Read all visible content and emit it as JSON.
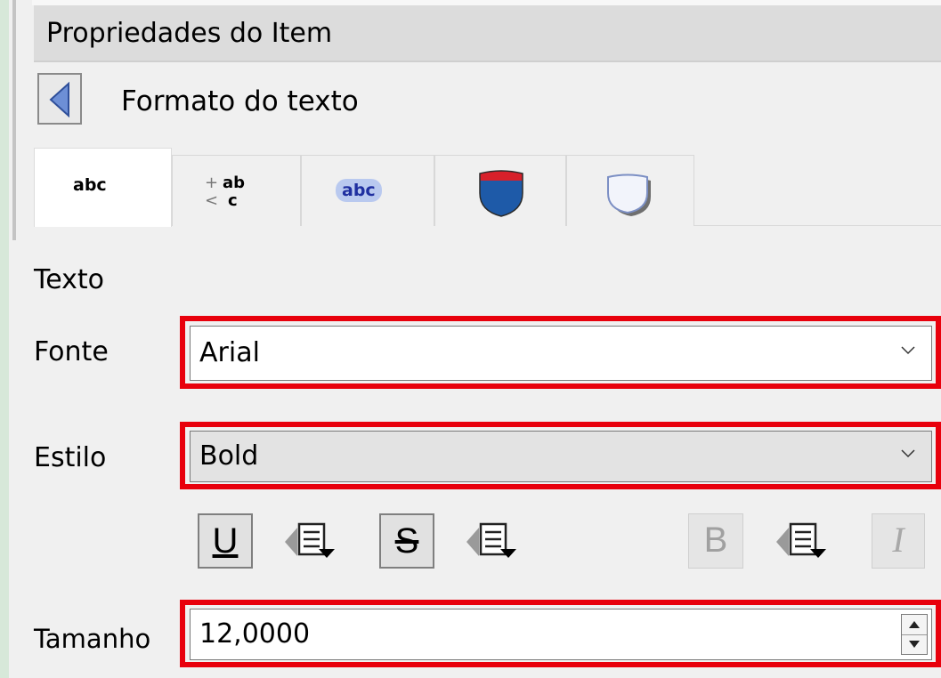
{
  "panel": {
    "title": "Propriedades do Item"
  },
  "section": {
    "title": "Formato do texto"
  },
  "tabs": [
    {
      "id": "text",
      "icon": "text-abc-icon",
      "glyph": "abc",
      "active": true
    },
    {
      "id": "formatting",
      "icon": "formatting-abc-icon",
      "glyph_top": "ab",
      "glyph_bottom": "c",
      "active": false
    },
    {
      "id": "buffer",
      "icon": "buffer-abc-icon",
      "glyph": "abc",
      "active": false
    },
    {
      "id": "background",
      "icon": "background-shield-icon",
      "active": false
    },
    {
      "id": "shadow",
      "icon": "shadow-shield-icon",
      "active": false
    }
  ],
  "text_group": {
    "label": "Texto",
    "font": {
      "label": "Fonte",
      "value": "Arial"
    },
    "style": {
      "label": "Estilo",
      "value": "Bold"
    },
    "toggles": {
      "underline": {
        "glyph": "U",
        "icon": "underline-icon"
      },
      "strikeout": {
        "glyph": "S",
        "icon": "strikeout-icon"
      },
      "bold": {
        "glyph": "B",
        "icon": "bold-icon",
        "enabled": false
      },
      "italic": {
        "glyph": "I",
        "icon": "italic-icon",
        "enabled": false
      },
      "override_icon": "data-defined-override-icon"
    },
    "size": {
      "label": "Tamanho",
      "value": "12,0000"
    }
  },
  "colors": {
    "highlight": "#e8000c",
    "accent_blue": "#1e5aa8",
    "accent_red": "#d7202a"
  }
}
